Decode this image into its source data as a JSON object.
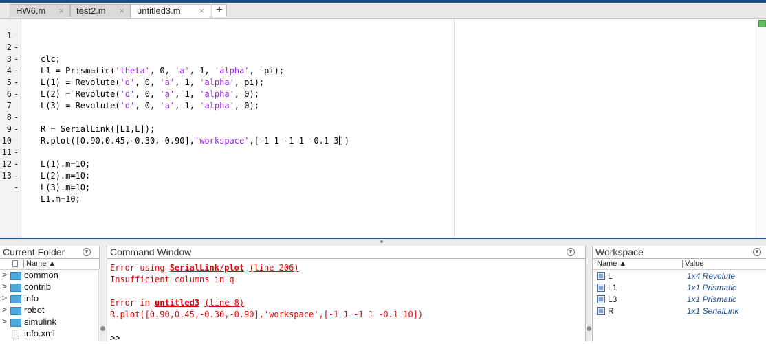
{
  "tabs": [
    {
      "label": "HW6.m",
      "close": "×"
    },
    {
      "label": "test2.m",
      "close": "×"
    },
    {
      "label": "untitled3.m",
      "close": "×"
    }
  ],
  "add_tab_label": "+",
  "editor": {
    "lines": [
      {
        "num": "1",
        "dash": "-",
        "text": "clc;"
      },
      {
        "num": "2",
        "dash": "-",
        "text": "L1 = Prismatic('theta', 0, 'a', 1, 'alpha', -pi);"
      },
      {
        "num": "3",
        "dash": "-",
        "text": "L(1) = Revolute('d', 0, 'a', 1, 'alpha', pi);"
      },
      {
        "num": "4",
        "dash": "-",
        "text": "L(2) = Revolute('d', 0, 'a', 1, 'alpha', 0);"
      },
      {
        "num": "5",
        "dash": "-",
        "text": "L(3) = Revolute('d', 0, 'a', 1, 'alpha', 0);"
      },
      {
        "num": "6",
        "dash": "",
        "text": ""
      },
      {
        "num": "7",
        "dash": "-",
        "text": "R = SerialLink([L1,L]);"
      },
      {
        "num": "8",
        "dash": "-",
        "text": "R.plot([0.90,0.45,-0.30,-0.90],'workspace',[-1 1 -1 1 -0.1 3])"
      },
      {
        "num": "9",
        "dash": "",
        "text": ""
      },
      {
        "num": "10",
        "dash": "-",
        "text": "L(1).m=10;"
      },
      {
        "num": "11",
        "dash": "-",
        "text": "L(2).m=10;"
      },
      {
        "num": "12",
        "dash": "-",
        "text": "L(3).m=10;"
      },
      {
        "num": "13",
        "dash": "-",
        "text": "L1.m=10;"
      }
    ]
  },
  "current_folder": {
    "title": "Current Folder",
    "column_name": "Name ▲",
    "items": [
      {
        "name": "common",
        "type": "folder"
      },
      {
        "name": "contrib",
        "type": "folder"
      },
      {
        "name": "info",
        "type": "folder"
      },
      {
        "name": "robot",
        "type": "folder"
      },
      {
        "name": "simulink",
        "type": "folder"
      },
      {
        "name": "info.xml",
        "type": "file"
      }
    ]
  },
  "command_window": {
    "title": "Command Window",
    "error1_prefix": "Error using ",
    "error1_func": "SerialLink/plot",
    "error1_line": "(line 206)",
    "error1_msg": "Insufficient columns in q",
    "error2_prefix": "Error in ",
    "error2_func": "untitled3",
    "error2_line": "(line 8)",
    "error2_code": "R.plot([0.90,0.45,-0.30,-0.90],'workspace',[-1 1 -1 1 -0.1 10])",
    "prompt": ">>"
  },
  "workspace": {
    "title": "Workspace",
    "column_name": "Name ▲",
    "column_value": "Value",
    "vars": [
      {
        "name": "L",
        "value": "1x4 Revolute"
      },
      {
        "name": "L1",
        "value": "1x1 Prismatic"
      },
      {
        "name": "L3",
        "value": "1x1 Prismatic"
      },
      {
        "name": "R",
        "value": "1x1 SerialLink"
      }
    ]
  },
  "colors": {
    "accent": "#1f4f8a",
    "string": "#a020f0",
    "error": "#e00000",
    "value": "#1f4f9a"
  }
}
